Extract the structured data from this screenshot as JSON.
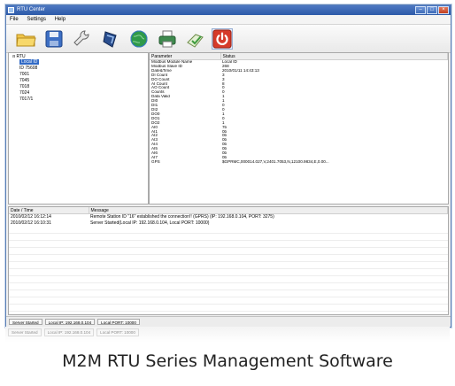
{
  "window": {
    "title": "RTU Center"
  },
  "menu": [
    "File",
    "Settings",
    "Help"
  ],
  "toolbar": {
    "buttons": [
      {
        "name": "open-folder",
        "icon": "folder-icon"
      },
      {
        "name": "save",
        "icon": "save-icon"
      },
      {
        "name": "settings",
        "icon": "wrench-icon"
      },
      {
        "name": "shield",
        "icon": "shield-icon"
      },
      {
        "name": "network",
        "icon": "globe-icon"
      },
      {
        "name": "print",
        "icon": "printer-icon"
      },
      {
        "name": "checklist",
        "icon": "check-icon"
      },
      {
        "name": "power",
        "icon": "power-icon"
      }
    ]
  },
  "tree": {
    "root": "RTU",
    "items": [
      "Local ID",
      "ID 75608",
      "7001",
      "7045",
      "7018",
      "7024",
      "7017/1"
    ]
  },
  "params": {
    "headers": [
      "Parameter",
      "Status"
    ],
    "rows": [
      [
        "Modbus Module Name",
        "Local ID"
      ],
      [
        "Modbus Slave ID",
        "268"
      ],
      [
        "Date&Time",
        "2010/01/11 14:43:13"
      ],
      [
        "DI Count",
        "3"
      ],
      [
        "DO Count",
        "3"
      ],
      [
        "AI Count",
        "8"
      ],
      [
        "AO Count",
        "0"
      ],
      [
        "Counts",
        "0"
      ],
      [
        "Data Valid",
        "1"
      ],
      [
        "DI0",
        "1"
      ],
      [
        "DI1",
        "0"
      ],
      [
        "DI2",
        "0"
      ],
      [
        "DO0",
        "1"
      ],
      [
        "DO1",
        "0"
      ],
      [
        "DO2",
        "1"
      ],
      [
        "AI0",
        "7b"
      ],
      [
        "AI1",
        "0b"
      ],
      [
        "AI2",
        "0b"
      ],
      [
        "AI3",
        "0b"
      ],
      [
        "AI4",
        "0b"
      ],
      [
        "AI5",
        "0b"
      ],
      [
        "AI6",
        "0b"
      ],
      [
        "AI7",
        "0b"
      ],
      [
        "GPS",
        "$GPRMC,000014.027,V,2401.7053,N,12100.9834,E,0.00..."
      ]
    ]
  },
  "log": {
    "headers": [
      "Date / Time",
      "Message"
    ],
    "rows": [
      [
        "2010/02/12  16:12:14",
        "Remote Station ID \"16\" established the connection!! (GPRS) (IP: 192.168.0.104, PORT: 3275)"
      ],
      [
        "2010/02/12  16:10:31",
        "Server Started(Local IP: 192.168.0.104, Local PORT: 10000)"
      ]
    ]
  },
  "statusbar": [
    "Server Started",
    "Local IP: 192.168.0.104",
    "Local PORT: 10000"
  ],
  "caption": "M2M RTU Series Management Software"
}
